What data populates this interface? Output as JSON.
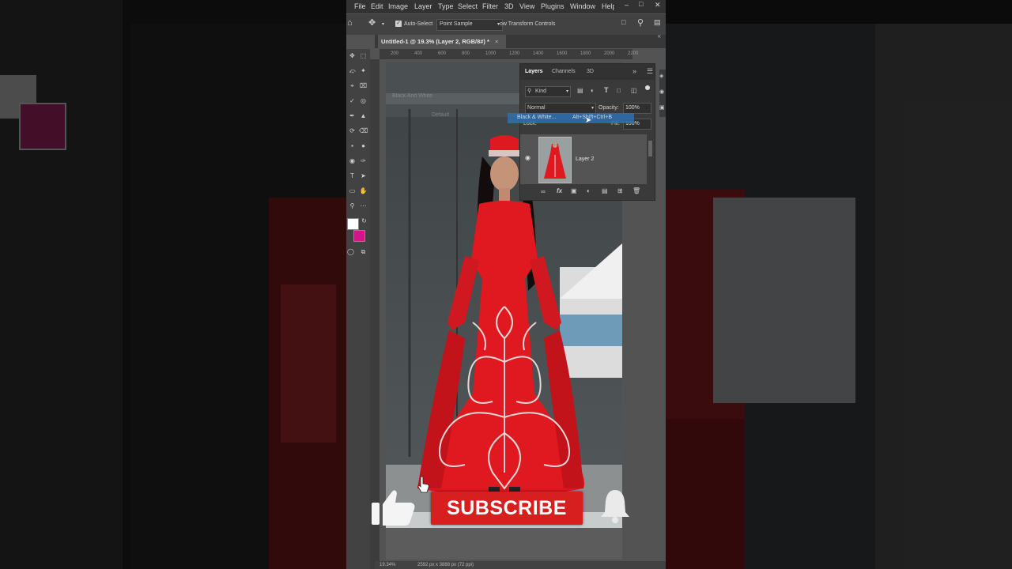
{
  "menu": {
    "items": [
      "File",
      "Edit",
      "Image",
      "Layer",
      "Type",
      "Select",
      "Filter",
      "3D",
      "View",
      "Plugins",
      "Window",
      "Help"
    ]
  },
  "options_bar": {
    "auto_select_label": "Auto-Select",
    "sample_value": "Point Sample",
    "transform_label": "ow Transform Controls"
  },
  "document": {
    "tab_title": "Untitled-1 @ 19.3% (Layer 2, RGB/8#) *",
    "ruler_ticks": [
      "200",
      "400",
      "600",
      "800",
      "1000",
      "1200",
      "1400",
      "1600",
      "1800",
      "2000",
      "2200"
    ],
    "status_zoom": "19.34%",
    "status_size": "2592 px x 3888 px (72 ppi)"
  },
  "adjustment_overlay": {
    "title": "Black And White",
    "preset": "Default"
  },
  "layers_panel": {
    "tabs": [
      "Layers",
      "Channels",
      "3D"
    ],
    "kind_label": "Kind",
    "blend_mode": "Normal",
    "opacity_label": "Opacity:",
    "opacity_value": "100%",
    "lock_label": "Lock:",
    "fill_label": "Fill:",
    "fill_value": "100%",
    "layer_name": "Layer 2",
    "context_item": "Black & White...",
    "context_shortcut": "Alt+Shift+Ctrl+B"
  },
  "overlay": {
    "subscribe_label": "SUBSCRIBE"
  },
  "colors": {
    "ps_bg": "#535353",
    "dress_red": "#e0181f",
    "foreground_swatch": "#ffffff",
    "background_swatch": "#d4148a",
    "subscribe_red": "#d81f1f"
  }
}
